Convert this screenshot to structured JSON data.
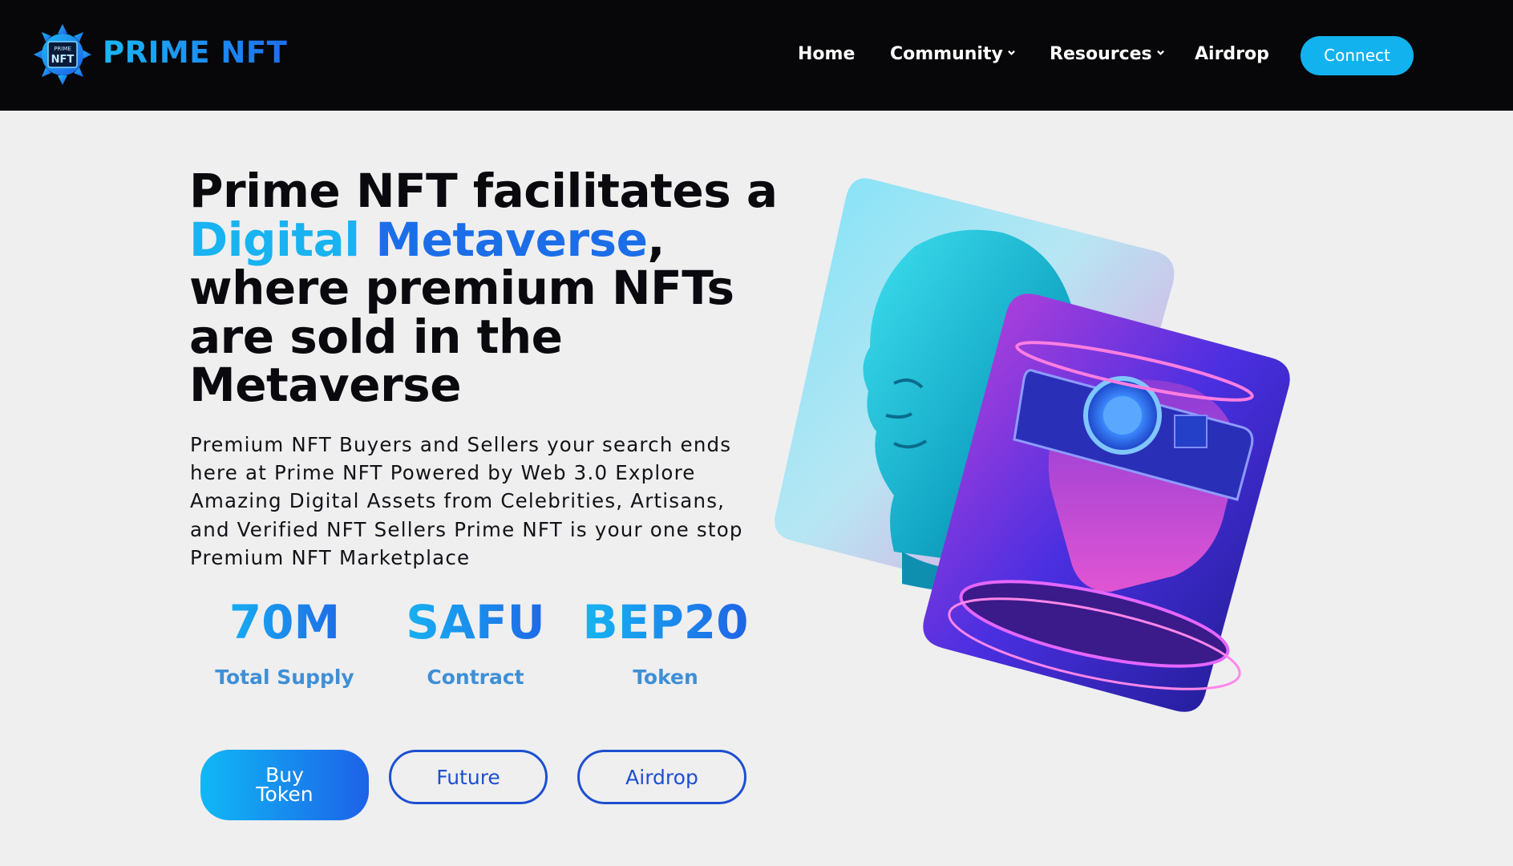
{
  "brand": {
    "name": "PRIME NFT",
    "icon": "prime-nft-gear-logo",
    "colors": {
      "accent": "#12b2ee",
      "accent_dark": "#1d4fd0",
      "nav_bg": "#070709",
      "page_bg": "#efeff0"
    }
  },
  "nav": {
    "items": [
      {
        "label": "Home",
        "dropdown": false
      },
      {
        "label": "Community",
        "dropdown": true
      },
      {
        "label": "Resources",
        "dropdown": true
      },
      {
        "label": "Airdrop",
        "dropdown": false
      }
    ],
    "connect_label": "Connect"
  },
  "hero": {
    "headline_line1": "Prime NFT facilitates a",
    "headline_highlight_a": "Digital ",
    "headline_highlight_b": "Metaverse",
    "headline_comma": ",",
    "headline_line3": "where premium NFTs",
    "headline_line4": "are sold in the",
    "headline_line5": "Metaverse",
    "paragraph": "Premium NFT Buyers and Sellers your search ends here at Prime NFT Powered by Web 3.0 Explore Amazing Digital Assets from Celebrities, Artisans, and Verified NFT Sellers Prime NFT is your one stop Premium NFT Marketplace",
    "stats": [
      {
        "value": "70M",
        "label": "Total Supply"
      },
      {
        "value": "SAFU",
        "label": "Contract"
      },
      {
        "value": "BEP20",
        "label": "Token"
      }
    ],
    "buttons": {
      "buy_line1": "Buy",
      "buy_line2": "Token",
      "future": "Future",
      "airdrop": "Airdrop"
    },
    "artwork": {
      "cards": [
        "statue-head-cyan",
        "cyber-head-vr-headset"
      ]
    }
  }
}
